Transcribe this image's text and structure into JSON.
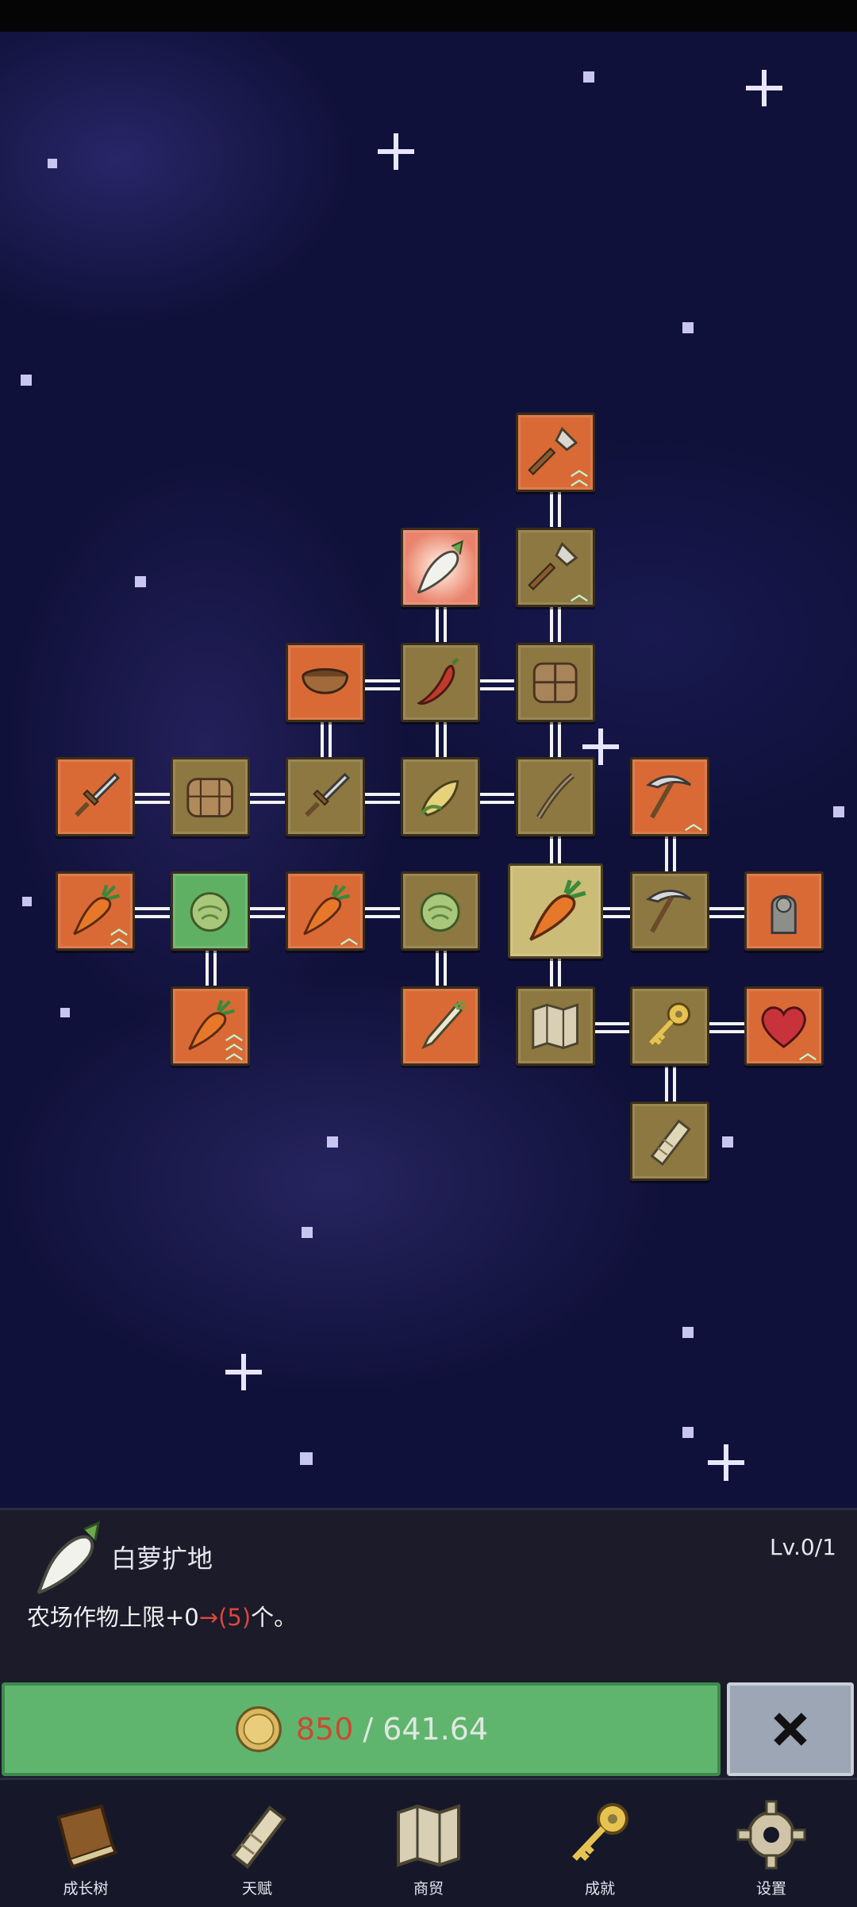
{
  "skill_tree": {
    "nodes": [
      {
        "id": "shovel-3",
        "icon": "shovel-icon",
        "color": "orange",
        "upgrade": "double-chevron"
      },
      {
        "id": "radish-expand",
        "icon": "radish-icon",
        "color": "pale",
        "selected_glow": true
      },
      {
        "id": "shovel-2",
        "icon": "shovel-icon",
        "color": "olive",
        "upgrade": "chevron"
      },
      {
        "id": "bowl",
        "icon": "bowl-icon",
        "color": "orange"
      },
      {
        "id": "chili",
        "icon": "chili-icon",
        "color": "olive"
      },
      {
        "id": "crate-1",
        "icon": "crate-icon",
        "color": "olive"
      },
      {
        "id": "sword-orange",
        "icon": "sword-icon",
        "color": "orange"
      },
      {
        "id": "chest",
        "icon": "chest-icon",
        "color": "olive"
      },
      {
        "id": "sword-olive",
        "icon": "sword-icon",
        "color": "olive"
      },
      {
        "id": "corn",
        "icon": "corn-icon",
        "color": "olive"
      },
      {
        "id": "fishing-rod",
        "icon": "rod-icon",
        "color": "olive"
      },
      {
        "id": "pickaxe-orange",
        "icon": "pickaxe-icon",
        "color": "orange",
        "upgrade": "chevron"
      },
      {
        "id": "carrot-boost-1",
        "icon": "carrot-icon",
        "color": "orange",
        "upgrade": "double-chevron"
      },
      {
        "id": "cabbage-green",
        "icon": "cabbage-icon",
        "color": "green"
      },
      {
        "id": "carrot-boost-2",
        "icon": "carrot-icon",
        "color": "orange",
        "upgrade": "chevron"
      },
      {
        "id": "cabbage-olive",
        "icon": "cabbage-icon",
        "color": "olive"
      },
      {
        "id": "carrot-root",
        "icon": "carrot-icon",
        "color": "big"
      },
      {
        "id": "pickaxe-olive",
        "icon": "pickaxe-icon",
        "color": "olive"
      },
      {
        "id": "statue",
        "icon": "statue-icon",
        "color": "orange"
      },
      {
        "id": "carrot-boost-3",
        "icon": "carrot-icon",
        "color": "orange",
        "upgrade": "triple-chevron"
      },
      {
        "id": "leek",
        "icon": "leek-icon",
        "color": "orange"
      },
      {
        "id": "map",
        "icon": "map-icon",
        "color": "olive"
      },
      {
        "id": "key",
        "icon": "key-icon",
        "color": "olive"
      },
      {
        "id": "heart",
        "icon": "heart-icon",
        "color": "orange",
        "upgrade": "chevron"
      },
      {
        "id": "scroll",
        "icon": "scroll-icon",
        "color": "olive"
      }
    ]
  },
  "detail": {
    "icon": "radish-icon",
    "name": "白萝扩地",
    "level": "Lv.0/1",
    "desc_prefix": "农场作物上限+0",
    "desc_arrow": "→",
    "desc_value": "(5)",
    "desc_suffix": "个。"
  },
  "purchase": {
    "coin_icon": "coin-icon",
    "have": "850",
    "separator": "/",
    "need": "641.64",
    "close_icon": "close-icon"
  },
  "nav": [
    {
      "label": "成长树",
      "icon": "book-icon"
    },
    {
      "label": "天赋",
      "icon": "scroll-icon"
    },
    {
      "label": "商贸",
      "icon": "map-icon"
    },
    {
      "label": "成就",
      "icon": "key-icon"
    },
    {
      "label": "设置",
      "icon": "gear-icon"
    }
  ],
  "colors": {
    "background": "#10113a",
    "node_olive": "#8c7840",
    "node_orange": "#d96a36",
    "node_green": "#5fb063",
    "buy_button": "#5fb56e",
    "close_button": "#9ca6b4",
    "highlight_red": "#e0463d"
  }
}
